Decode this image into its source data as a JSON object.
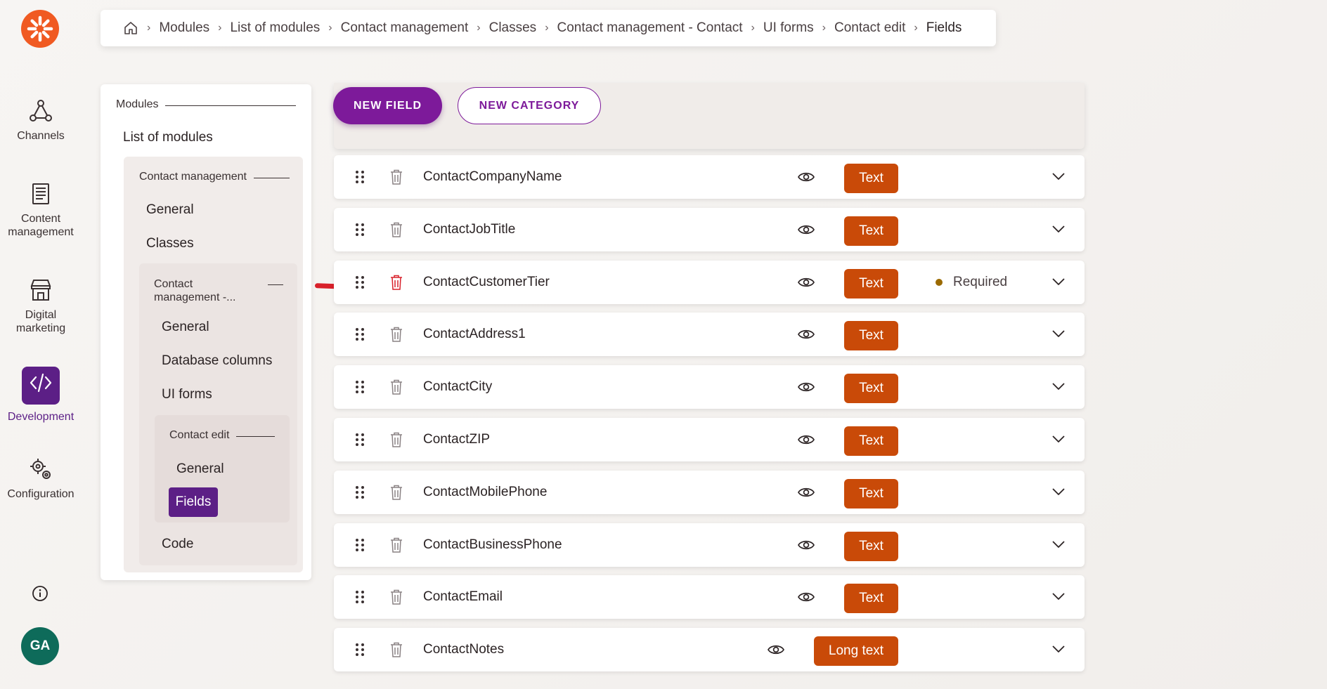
{
  "rail": {
    "items": [
      {
        "label": "Channels",
        "icon": "channels-icon"
      },
      {
        "label": "Content management",
        "icon": "content-management-icon"
      },
      {
        "label": "Digital marketing",
        "icon": "storefront-icon"
      },
      {
        "label": "Development",
        "icon": "code-icon",
        "active": true
      },
      {
        "label": "Configuration",
        "icon": "gears-icon"
      }
    ],
    "avatar": "GA"
  },
  "breadcrumb": [
    "Modules",
    "List of modules",
    "Contact management",
    "Classes",
    "Contact management - Contact",
    "UI forms",
    "Contact edit",
    "Fields"
  ],
  "tree": {
    "heading": "Modules",
    "list_of_modules": "List of modules",
    "module": {
      "heading": "Contact management",
      "general": "General",
      "classes": "Classes",
      "class": {
        "heading_line1": "Contact",
        "heading_line2": "management -...",
        "general": "General",
        "database_columns": "Database columns",
        "ui_forms": "UI forms",
        "form": {
          "heading": "Contact edit",
          "general": "General",
          "fields": "Fields"
        },
        "code": "Code"
      }
    }
  },
  "toolbar": {
    "new_field": "NEW FIELD",
    "new_category": "NEW CATEGORY"
  },
  "fields": [
    {
      "name": "ContactCompanyName",
      "type": "Text",
      "required": false
    },
    {
      "name": "ContactJobTitle",
      "type": "Text",
      "required": false
    },
    {
      "name": "ContactCustomerTier",
      "type": "Text",
      "required": true,
      "required_label": "Required"
    },
    {
      "name": "ContactAddress1",
      "type": "Text",
      "required": false
    },
    {
      "name": "ContactCity",
      "type": "Text",
      "required": false
    },
    {
      "name": "ContactZIP",
      "type": "Text",
      "required": false
    },
    {
      "name": "ContactMobilePhone",
      "type": "Text",
      "required": false
    },
    {
      "name": "ContactBusinessPhone",
      "type": "Text",
      "required": false
    },
    {
      "name": "ContactEmail",
      "type": "Text",
      "required": false
    },
    {
      "name": "ContactNotes",
      "type": "Long text",
      "required": false
    }
  ],
  "colors": {
    "brand_orange": "#f05a22",
    "accent_purple": "#7d1a9a",
    "active_purple": "#5c1f86",
    "badge_orange": "#c94a08",
    "trash_hover_red": "#d8202a"
  }
}
